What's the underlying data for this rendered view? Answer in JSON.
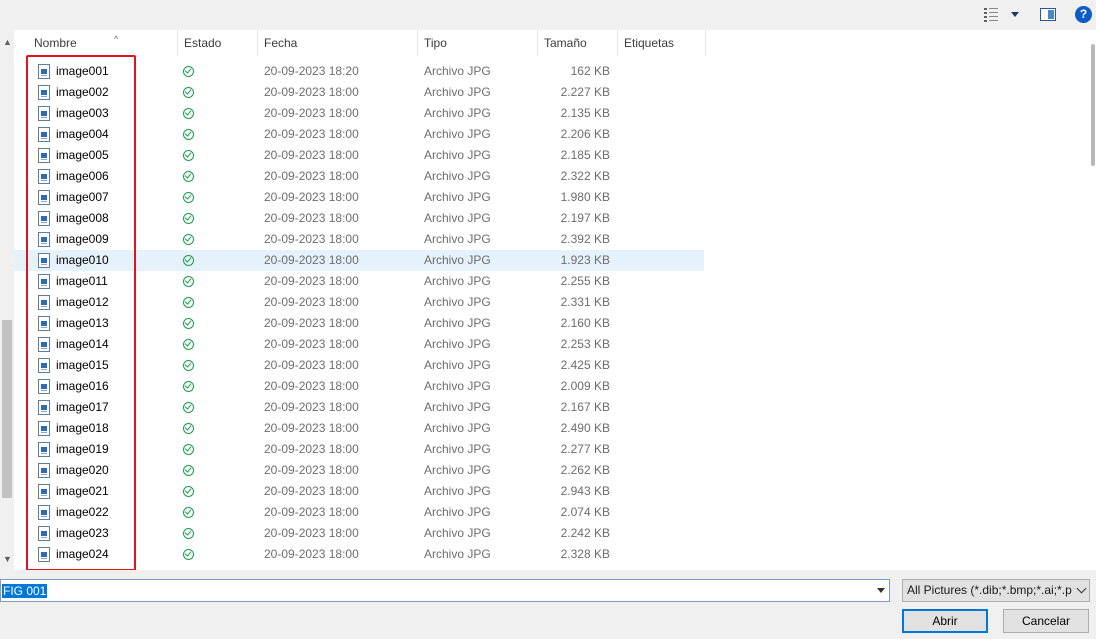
{
  "columns": {
    "name": "Nombre",
    "status": "Estado",
    "date": "Fecha",
    "type": "Tipo",
    "size": "Tamaño",
    "tags": "Etiquetas"
  },
  "files": [
    {
      "name": "image001",
      "date": "20-09-2023 18:20",
      "type": "Archivo JPG",
      "size": "162 KB"
    },
    {
      "name": "image002",
      "date": "20-09-2023 18:00",
      "type": "Archivo JPG",
      "size": "2.227 KB"
    },
    {
      "name": "image003",
      "date": "20-09-2023 18:00",
      "type": "Archivo JPG",
      "size": "2.135 KB"
    },
    {
      "name": "image004",
      "date": "20-09-2023 18:00",
      "type": "Archivo JPG",
      "size": "2.206 KB"
    },
    {
      "name": "image005",
      "date": "20-09-2023 18:00",
      "type": "Archivo JPG",
      "size": "2.185 KB"
    },
    {
      "name": "image006",
      "date": "20-09-2023 18:00",
      "type": "Archivo JPG",
      "size": "2.322 KB"
    },
    {
      "name": "image007",
      "date": "20-09-2023 18:00",
      "type": "Archivo JPG",
      "size": "1.980 KB"
    },
    {
      "name": "image008",
      "date": "20-09-2023 18:00",
      "type": "Archivo JPG",
      "size": "2.197 KB"
    },
    {
      "name": "image009",
      "date": "20-09-2023 18:00",
      "type": "Archivo JPG",
      "size": "2.392 KB"
    },
    {
      "name": "image010",
      "date": "20-09-2023 18:00",
      "type": "Archivo JPG",
      "size": "1.923 KB"
    },
    {
      "name": "image011",
      "date": "20-09-2023 18:00",
      "type": "Archivo JPG",
      "size": "2.255 KB"
    },
    {
      "name": "image012",
      "date": "20-09-2023 18:00",
      "type": "Archivo JPG",
      "size": "2.331 KB"
    },
    {
      "name": "image013",
      "date": "20-09-2023 18:00",
      "type": "Archivo JPG",
      "size": "2.160 KB"
    },
    {
      "name": "image014",
      "date": "20-09-2023 18:00",
      "type": "Archivo JPG",
      "size": "2.253 KB"
    },
    {
      "name": "image015",
      "date": "20-09-2023 18:00",
      "type": "Archivo JPG",
      "size": "2.425 KB"
    },
    {
      "name": "image016",
      "date": "20-09-2023 18:00",
      "type": "Archivo JPG",
      "size": "2.009 KB"
    },
    {
      "name": "image017",
      "date": "20-09-2023 18:00",
      "type": "Archivo JPG",
      "size": "2.167 KB"
    },
    {
      "name": "image018",
      "date": "20-09-2023 18:00",
      "type": "Archivo JPG",
      "size": "2.490 KB"
    },
    {
      "name": "image019",
      "date": "20-09-2023 18:00",
      "type": "Archivo JPG",
      "size": "2.277 KB"
    },
    {
      "name": "image020",
      "date": "20-09-2023 18:00",
      "type": "Archivo JPG",
      "size": "2.262 KB"
    },
    {
      "name": "image021",
      "date": "20-09-2023 18:00",
      "type": "Archivo JPG",
      "size": "2.943 KB"
    },
    {
      "name": "image022",
      "date": "20-09-2023 18:00",
      "type": "Archivo JPG",
      "size": "2.074 KB"
    },
    {
      "name": "image023",
      "date": "20-09-2023 18:00",
      "type": "Archivo JPG",
      "size": "2.242 KB"
    },
    {
      "name": "image024",
      "date": "20-09-2023 18:00",
      "type": "Archivo JPG",
      "size": "2.328 KB"
    }
  ],
  "selected_index": 9,
  "toolbar": {
    "view_icon": "view-options-icon",
    "preview_icon": "preview-pane-icon",
    "help_label": "?"
  },
  "filename": {
    "value": "FIG 001"
  },
  "filter": {
    "selected": "All Pictures (*.dib;*.bmp;*.ai;*.p"
  },
  "buttons": {
    "open": "Abrir",
    "cancel": "Cancelar"
  },
  "colors": {
    "accent": "#0078d7",
    "highlight_border": "#e0141c",
    "status_green": "#1a9e4b",
    "selected_row": "#e5f1fb"
  }
}
